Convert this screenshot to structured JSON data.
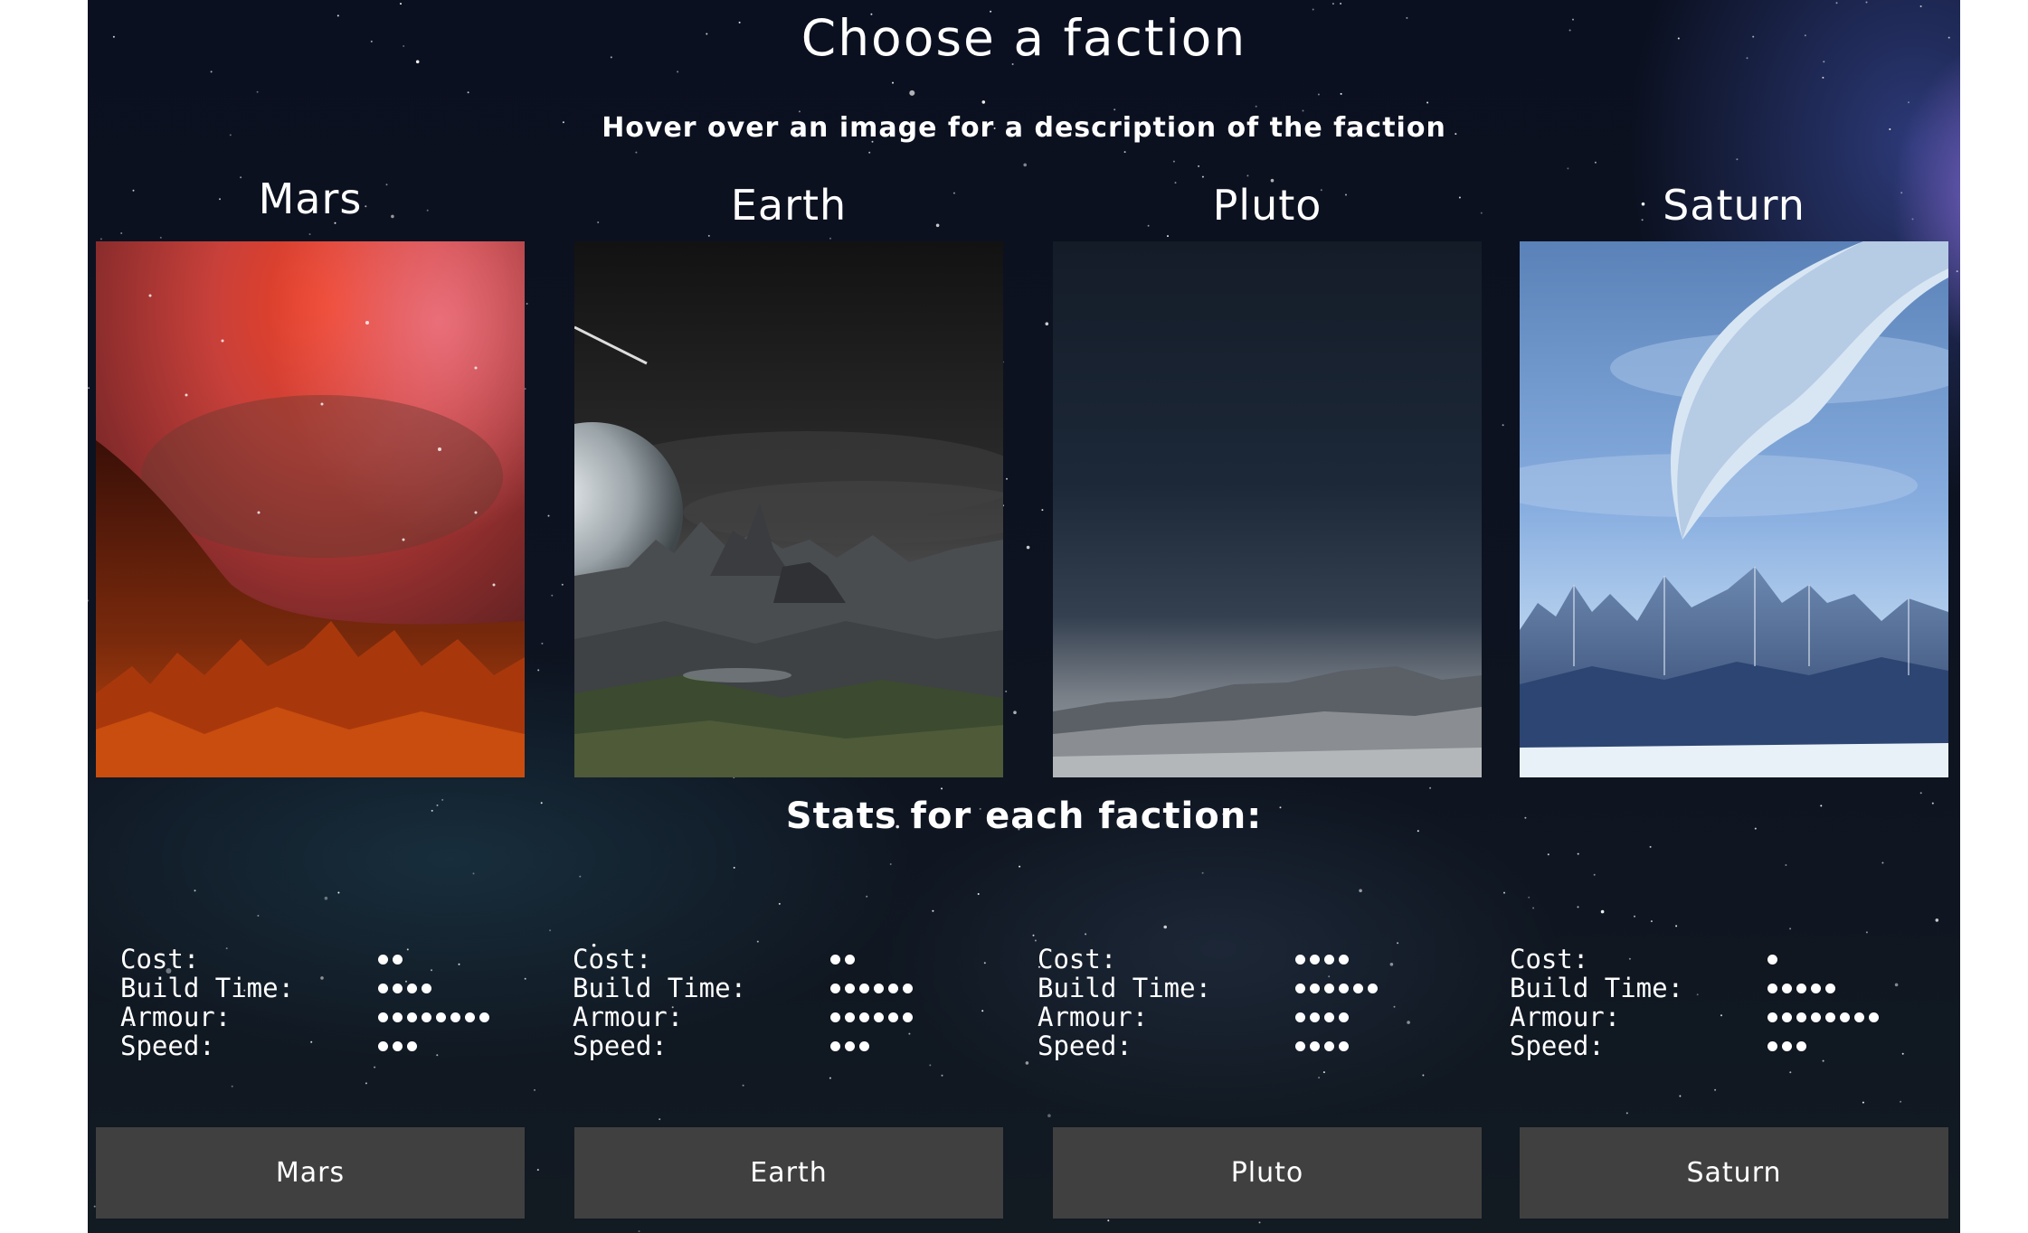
{
  "title": "Choose a faction",
  "subtitle": "Hover over an image for a description of the faction",
  "stats_title": "Stats for each faction:",
  "stat_labels": {
    "cost": "Cost:",
    "build_time": "Build Time:",
    "armour": "Armour:",
    "speed": "Speed:"
  },
  "factions": [
    {
      "name": "Mars",
      "button": "Mars",
      "stats": {
        "cost": 2,
        "build_time": 4,
        "armour": 8,
        "speed": 3
      }
    },
    {
      "name": "Earth",
      "button": "Earth",
      "stats": {
        "cost": 2,
        "build_time": 6,
        "armour": 6,
        "speed": 3
      }
    },
    {
      "name": "Pluto",
      "button": "Pluto",
      "stats": {
        "cost": 4,
        "build_time": 6,
        "armour": 4,
        "speed": 4
      }
    },
    {
      "name": "Saturn",
      "button": "Saturn",
      "stats": {
        "cost": 1,
        "build_time": 5,
        "armour": 8,
        "speed": 3
      }
    }
  ],
  "colors": {
    "button_bg": "#404040",
    "text": "#ffffff",
    "space_bg": "#0d1320"
  }
}
